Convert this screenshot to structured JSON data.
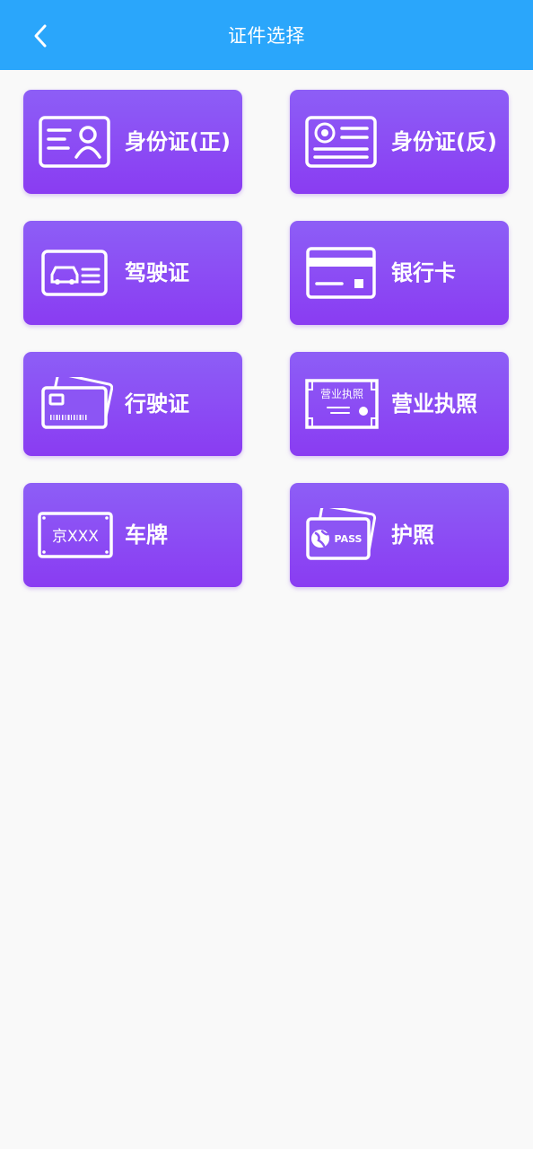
{
  "header": {
    "title": "证件选择",
    "back_icon": "chevron-left-icon"
  },
  "colors": {
    "header_bg": "#2aa6fb",
    "card_gradient_top": "#8d5ef6",
    "card_gradient_bottom": "#8a3cf2",
    "background": "#f9f9f9"
  },
  "cards": [
    {
      "label": "身份证(正)",
      "icon": "id-card-front-icon"
    },
    {
      "label": "身份证(反)",
      "icon": "id-card-back-icon"
    },
    {
      "label": "驾驶证",
      "icon": "driver-license-icon"
    },
    {
      "label": "银行卡",
      "icon": "bank-card-icon"
    },
    {
      "label": "行驶证",
      "icon": "vehicle-license-icon"
    },
    {
      "label": "营业执照",
      "icon": "business-license-icon",
      "icon_text": "营业执照"
    },
    {
      "label": "车牌",
      "icon": "license-plate-icon",
      "icon_text": "京XXX"
    },
    {
      "label": "护照",
      "icon": "passport-icon",
      "icon_text": "PASS"
    }
  ]
}
